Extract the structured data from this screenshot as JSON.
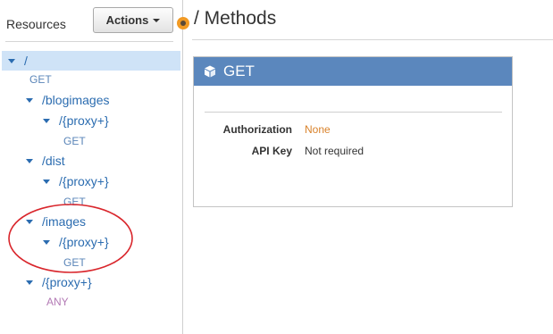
{
  "left_panel": {
    "title": "Resources",
    "actions_button": "Actions"
  },
  "tree": {
    "root": {
      "label": "/",
      "methods": [
        "GET"
      ]
    },
    "blogimages": {
      "label": "/blogimages",
      "proxy_label": "/{proxy+}",
      "proxy_method": "GET"
    },
    "dist": {
      "label": "/dist",
      "proxy_label": "/{proxy+}",
      "proxy_method": "GET"
    },
    "images": {
      "label": "/images",
      "proxy_label": "/{proxy+}",
      "proxy_method": "GET"
    },
    "root_proxy": {
      "label": "/{proxy+}",
      "method": "ANY"
    }
  },
  "main": {
    "title": "/ Methods",
    "method_card": {
      "method": "GET",
      "rows": [
        {
          "key": "Authorization",
          "value": "None"
        },
        {
          "key": "API Key",
          "value": "Not required"
        }
      ]
    }
  },
  "colors": {
    "link_blue": "#2b6cb0",
    "card_header": "#5b87bd",
    "selected_row": "#cfe3f7",
    "authorization_value": "#d9822b",
    "any_method": "#b37ab5",
    "annotation_ellipse": "#d9262c",
    "resize_handle": "#f19a24"
  },
  "icons": {
    "card_header_icon": "cube-icon",
    "expand_icon": "triangle-down-icon"
  }
}
